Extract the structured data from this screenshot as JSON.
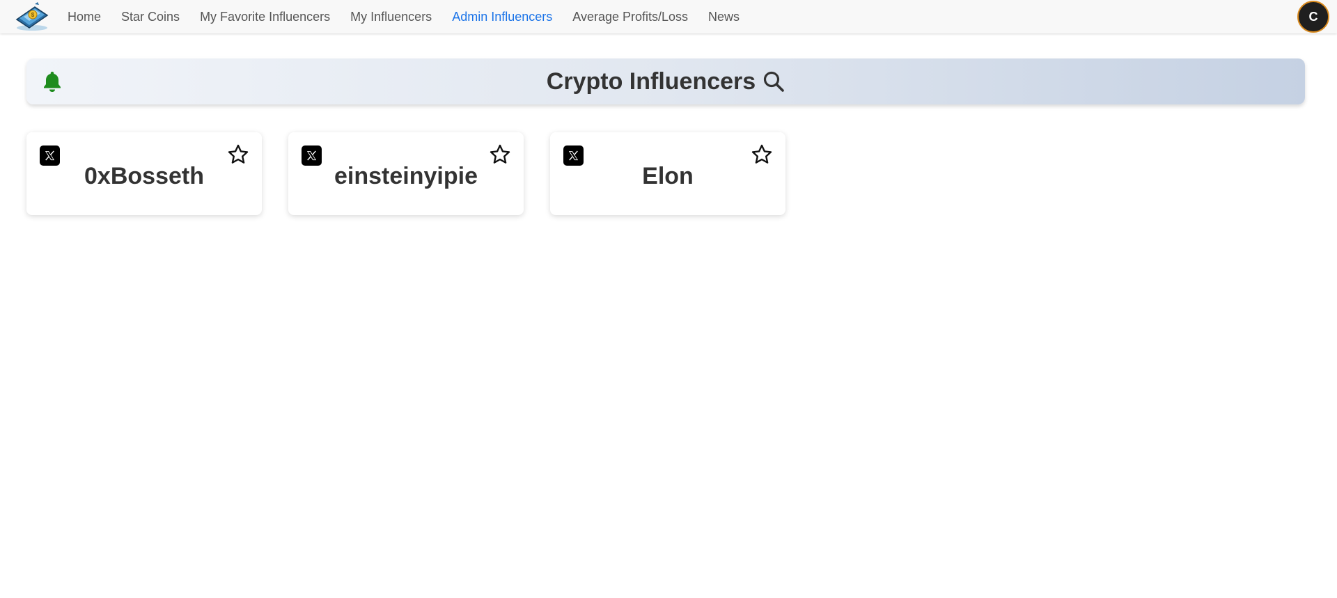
{
  "nav": {
    "items": [
      {
        "label": "Home",
        "active": false
      },
      {
        "label": "Star Coins",
        "active": false
      },
      {
        "label": "My Favorite Influencers",
        "active": false
      },
      {
        "label": "My Influencers",
        "active": false
      },
      {
        "label": "Admin Influencers",
        "active": true
      },
      {
        "label": "Average Profits/Loss",
        "active": false
      },
      {
        "label": "News",
        "active": false
      }
    ],
    "avatar_letter": "C",
    "logo_icon": "crypto-wallet-logo"
  },
  "banner": {
    "title": "Crypto Influencers",
    "bell_icon": "bell-icon",
    "search_icon": "search-icon"
  },
  "influencers": [
    {
      "name": "0xBosseth",
      "platform_icon": "x-logo-icon",
      "favorite": false
    },
    {
      "name": "einsteinyipie",
      "platform_icon": "x-logo-icon",
      "favorite": false
    },
    {
      "name": "Elon",
      "platform_icon": "x-logo-icon",
      "favorite": false
    }
  ],
  "colors": {
    "accent": "#1a73e8",
    "bell": "#1e8c1e",
    "avatar_bg": "#1f1f1f",
    "avatar_border": "#d98a1e"
  }
}
